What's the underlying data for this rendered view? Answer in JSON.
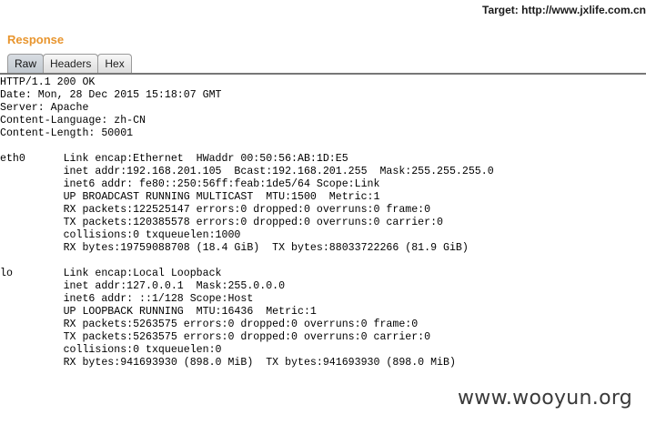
{
  "header": {
    "target_text": "Target: http://www.jxlife.com.cn"
  },
  "response": {
    "title": "Response",
    "tabs": [
      {
        "label": "Raw",
        "active": true
      },
      {
        "label": "Headers",
        "active": false
      },
      {
        "label": "Hex",
        "active": false
      }
    ],
    "body_lines": [
      "HTTP/1.1 200 OK",
      "Date: Mon, 28 Dec 2015 15:18:07 GMT",
      "Server: Apache",
      "Content-Language: zh-CN",
      "Content-Length: 50001",
      "",
      "eth0      Link encap:Ethernet  HWaddr 00:50:56:AB:1D:E5",
      "          inet addr:192.168.201.105  Bcast:192.168.201.255  Mask:255.255.255.0",
      "          inet6 addr: fe80::250:56ff:feab:1de5/64 Scope:Link",
      "          UP BROADCAST RUNNING MULTICAST  MTU:1500  Metric:1",
      "          RX packets:122525147 errors:0 dropped:0 overruns:0 frame:0",
      "          TX packets:120385578 errors:0 dropped:0 overruns:0 carrier:0",
      "          collisions:0 txqueuelen:1000",
      "          RX bytes:19759088708 (18.4 GiB)  TX bytes:88033722266 (81.9 GiB)",
      "",
      "lo        Link encap:Local Loopback",
      "          inet addr:127.0.0.1  Mask:255.0.0.0",
      "          inet6 addr: ::1/128 Scope:Host",
      "          UP LOOPBACK RUNNING  MTU:16436  Metric:1",
      "          RX packets:5263575 errors:0 dropped:0 overruns:0 frame:0",
      "          TX packets:5263575 errors:0 dropped:0 overruns:0 carrier:0",
      "          collisions:0 txqueuelen:0",
      "          RX bytes:941693930 (898.0 MiB)  TX bytes:941693930 (898.0 MiB)"
    ]
  },
  "watermark": {
    "text": "www.wooyun.org"
  }
}
